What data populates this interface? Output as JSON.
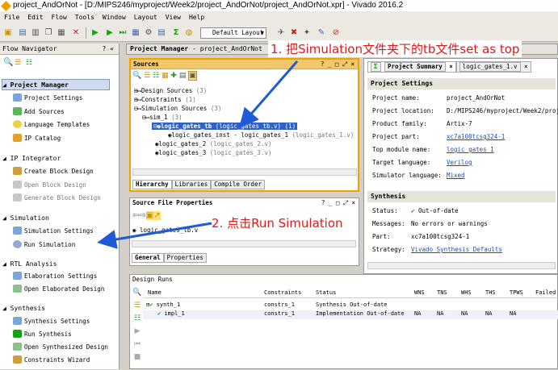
{
  "window": {
    "title": "project_AndOrNot - [D:/MIPS246/myproject/Week2/project_AndOrNot/project_AndOrNot.xpr] - Vivado 2016.2"
  },
  "menu": [
    "File",
    "Edit",
    "Flow",
    "Tools",
    "Window",
    "Layout",
    "View",
    "Help"
  ],
  "toolbar": {
    "layout_select": "Default Layout"
  },
  "flow_navigator": {
    "title": "Flow Navigator",
    "controls": "? «",
    "sections": [
      {
        "label": "Project Manager",
        "items": [
          "Project Settings",
          "Add Sources",
          "Language Templates",
          "IP Catalog"
        ]
      },
      {
        "label": "IP Integrator",
        "items": [
          "Create Block Design",
          "Open Block Design",
          "Generate Block Design"
        ]
      },
      {
        "label": "Simulation",
        "items": [
          "Simulation Settings",
          "Run Simulation"
        ]
      },
      {
        "label": "RTL Analysis",
        "items": [
          "Elaboration Settings",
          "Open Elaborated Design"
        ]
      },
      {
        "label": "Synthesis",
        "items": [
          "Synthesis Settings",
          "Run Synthesis",
          "Open Synthesized Design",
          "Constraints Wizard"
        ]
      }
    ]
  },
  "pm_header": {
    "title": "Project Manager",
    "subtitle": " - project_AndOrNot"
  },
  "sources": {
    "title": "Sources",
    "controls": "? _ □ ⤢ ×",
    "tree": [
      {
        "label": "Design Sources",
        "count": "(3)"
      },
      {
        "label": "Constraints",
        "count": "(1)"
      },
      {
        "label": "Simulation Sources",
        "count": "(3)"
      },
      {
        "label": "sim_1",
        "count": "(3)"
      },
      {
        "label": "logic_gates_tb",
        "file": "(logic_gates_tb.v)",
        "count": "(1)"
      },
      {
        "label": "logic_gates_inst - logic_gates_1",
        "file": "(logic_gates_1.v)"
      },
      {
        "label": "logic_gates_2",
        "file": "(logic_gates_2.v)"
      },
      {
        "label": "logic_gates_3",
        "file": "(logic_gates_3.v)"
      }
    ],
    "tabs": [
      "Hierarchy",
      "Libraries",
      "Compile Order"
    ]
  },
  "summary": {
    "tabs": [
      "Project Summary",
      "logic_gates_1.v"
    ],
    "settings_title": "Project Settings",
    "rows": [
      {
        "k": "Project name:",
        "v": "project_AndOrNot"
      },
      {
        "k": "Project location:",
        "v": "D:/MIPS246/myproject/Week2/proj"
      },
      {
        "k": "Product family:",
        "v": "Artix-7"
      },
      {
        "k": "Project part:",
        "v": "xc7a100tcsg324-1"
      },
      {
        "k": "Top module name:",
        "v": "logic_gates_1"
      },
      {
        "k": "Target language:",
        "v": "Verilog"
      },
      {
        "k": "Simulator language:",
        "v": "Mixed"
      }
    ],
    "synthesis_title": "Synthesis",
    "synth_rows": [
      {
        "k": "Status:",
        "v": "Out-of-date"
      },
      {
        "k": "Messages:",
        "v": "No errors or warnings"
      },
      {
        "k": "Part:",
        "v": "xc7a100tcsg324-1"
      },
      {
        "k": "Strategy:",
        "v": "Vivado Synthesis Defaults"
      }
    ]
  },
  "source_props": {
    "title": "Source File Properties",
    "controls": "? _ □ ⤢ ×",
    "file": "logic_gates_tb.v",
    "tabs": [
      "General",
      "Properties"
    ]
  },
  "design_runs": {
    "title": "Design Runs",
    "headers": [
      "Name",
      "Constraints",
      "Status",
      "WNS",
      "TNS",
      "WHS",
      "THS",
      "TPWS",
      "Failed"
    ],
    "rows": [
      {
        "name": "synth_1",
        "constraints": "constrs_1",
        "status": "Synthesis Out-of-date",
        "wns": "",
        "tns": "",
        "whs": "",
        "ths": "",
        "tpws": ""
      },
      {
        "name": "impl_1",
        "constraints": "constrs_1",
        "status": "Implementation Out-of-date",
        "wns": "NA",
        "tns": "NA",
        "whs": "NA",
        "ths": "NA",
        "tpws": "NA"
      }
    ]
  },
  "annotations": {
    "a1": "1. 把Simulation文件夹下的tb文件set as top",
    "a2": "2. 点击Run Simulation"
  },
  "colors": {
    "accent_orange": "#f0a000",
    "arrow_blue": "#1e5bd6",
    "annotation_red": "#e01818",
    "link_blue": "#1a4fb5"
  }
}
